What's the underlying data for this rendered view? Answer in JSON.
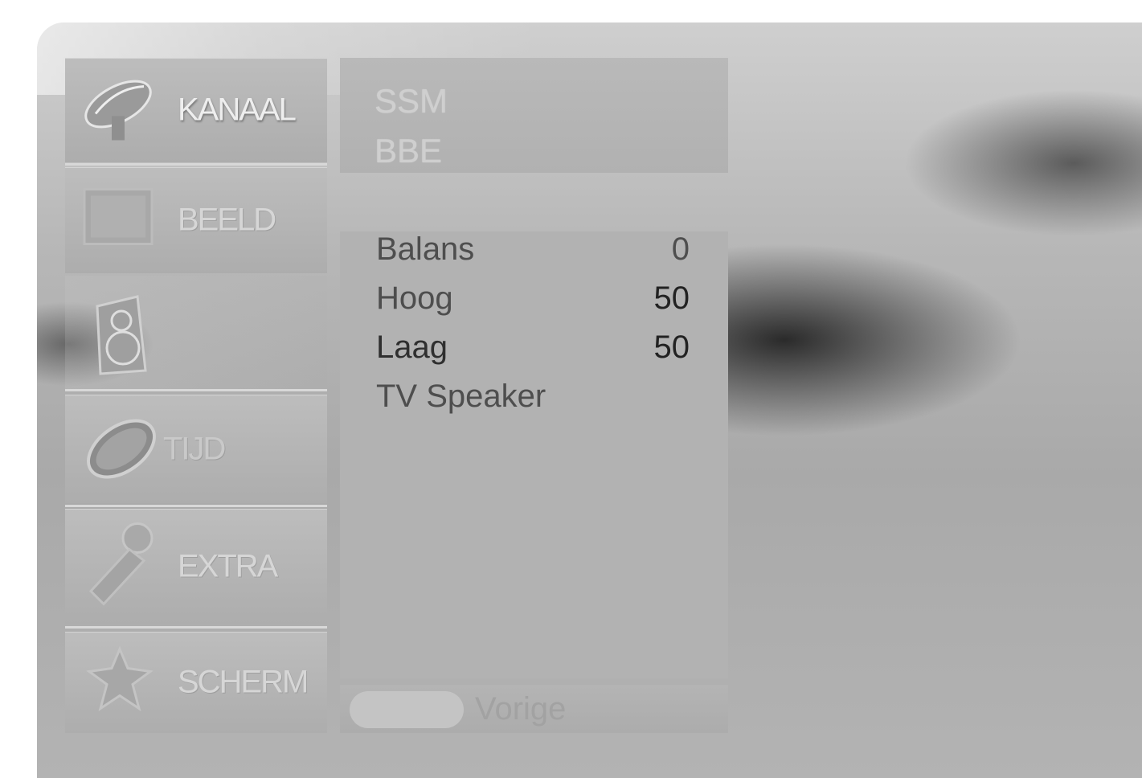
{
  "menu": {
    "items": [
      {
        "label": "KANAAL",
        "icon": "satellite-dish-icon"
      },
      {
        "label": "BEELD",
        "icon": "picture-icon"
      },
      {
        "label": "",
        "icon": "speaker-icon"
      },
      {
        "label": "TIJD",
        "icon": "clock-icon"
      },
      {
        "label": "EXTRA",
        "icon": "tool-icon"
      },
      {
        "label": "SCHERM",
        "icon": "screen-setup-icon"
      }
    ]
  },
  "submenu_top": {
    "options": [
      "SSM",
      "BBE"
    ]
  },
  "submenu_main": {
    "rows": [
      {
        "label": "Balans",
        "value": "0"
      },
      {
        "label": "Hoog",
        "value": "50"
      },
      {
        "label": "Laag",
        "value": "50"
      },
      {
        "label": "TV Speaker",
        "value": ""
      }
    ]
  },
  "footer": {
    "hint": "Vorige"
  }
}
